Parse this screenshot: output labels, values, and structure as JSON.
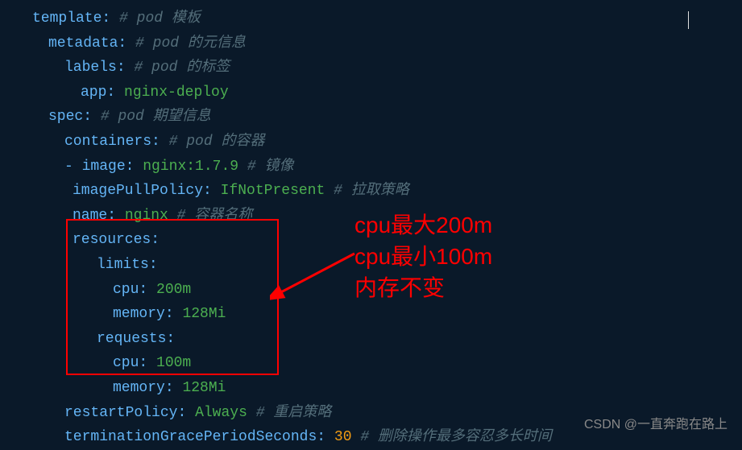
{
  "lines": {
    "template_key": "template",
    "template_comment": "# pod 模板",
    "metadata_key": "metadata",
    "metadata_comment": "# pod 的元信息",
    "labels_key": "labels",
    "labels_comment": "# pod 的标签",
    "app_key": "app",
    "app_value": "nginx-deploy",
    "spec_key": "spec",
    "spec_comment": "# pod 期望信息",
    "containers_key": "containers",
    "containers_comment": "# pod 的容器",
    "image_key": "image",
    "image_value": "nginx:1.7.9",
    "image_comment": "# 镜像",
    "imagePull_key": "imagePullPolicy",
    "imagePull_value": "IfNotPresent",
    "imagePull_comment": "# 拉取策略",
    "name_key": "name",
    "name_value": "nginx",
    "name_comment": "# 容器名称",
    "resources_key": "resources",
    "limits_key": "limits",
    "cpu_key": "cpu",
    "limits_cpu": "200m",
    "memory_key": "memory",
    "limits_memory": "128Mi",
    "requests_key": "requests",
    "requests_cpu": "100m",
    "requests_memory": "128Mi",
    "restart_key": "restartPolicy",
    "restart_value": "Always",
    "restart_comment": "# 重启策略",
    "termGrace_key": "terminationGracePeriodSeconds",
    "termGrace_value": "30",
    "termGrace_comment": "# 删除操作最多容忍多长时间"
  },
  "annotation": {
    "l1": "cpu最大200m",
    "l2": "cpu最小100m",
    "l3": "内存不变"
  },
  "watermark": "CSDN @一直奔跑在路上"
}
